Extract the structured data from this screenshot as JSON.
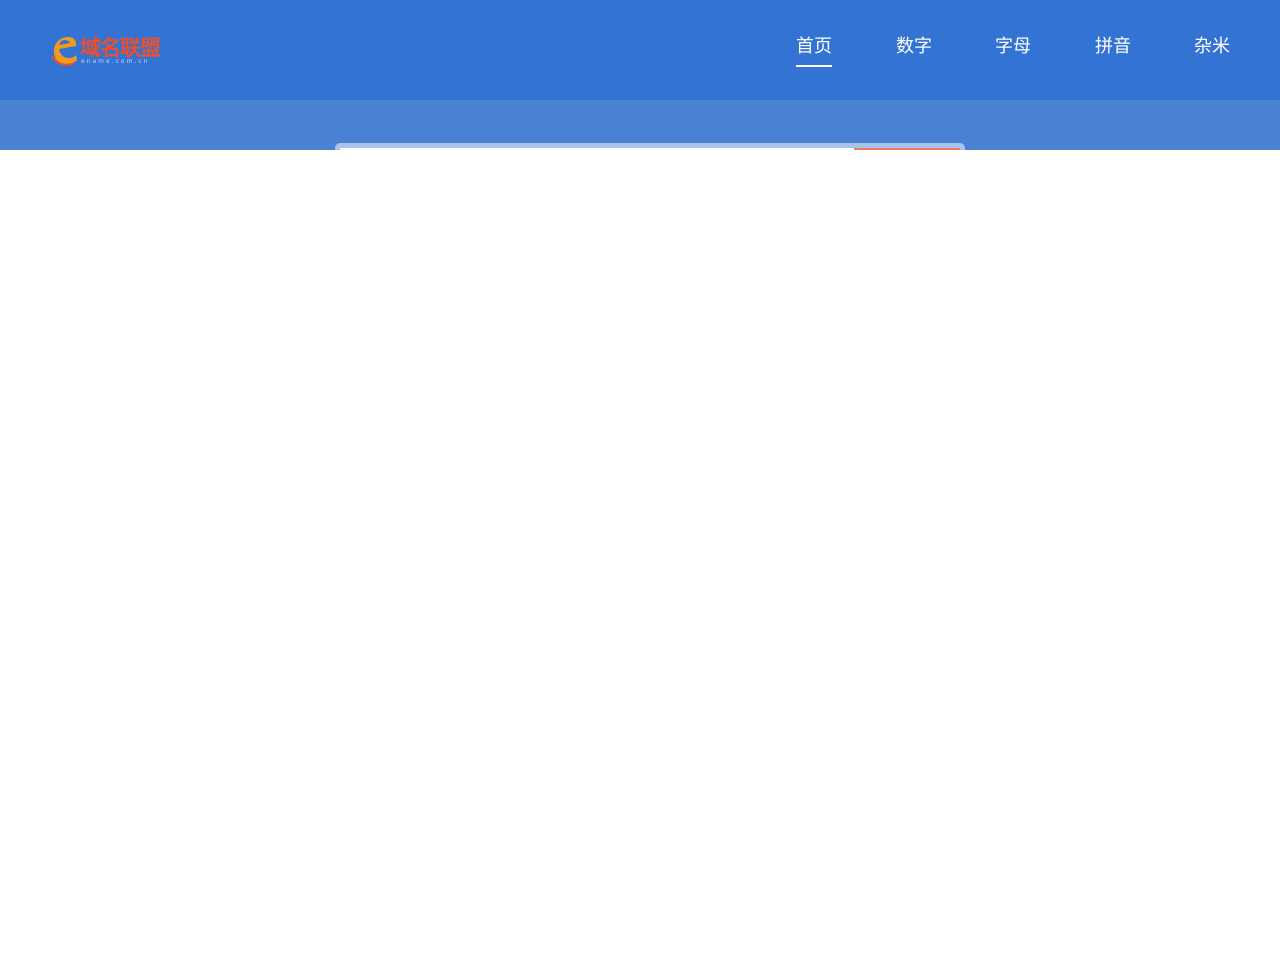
{
  "header": {
    "logo": {
      "glyph": "e",
      "text": "域名联盟",
      "subtext": "ename.com.cn",
      "colors": {
        "glyph": "#f39a1e",
        "text": "#e8502e",
        "subtext": "#c9d6ee"
      }
    },
    "background_color": "#3273d3"
  },
  "nav": {
    "items": [
      {
        "label": "首页",
        "active": true
      },
      {
        "label": "数字",
        "active": false
      },
      {
        "label": "字母",
        "active": false
      },
      {
        "label": "拼音",
        "active": false
      },
      {
        "label": "杂米",
        "active": false
      }
    ]
  },
  "search": {
    "input_value": "",
    "placeholder": "",
    "button_color": "#f07a5a",
    "frame_color": "#a9c3ea"
  },
  "band": {
    "background_color": "#4a81d3"
  }
}
